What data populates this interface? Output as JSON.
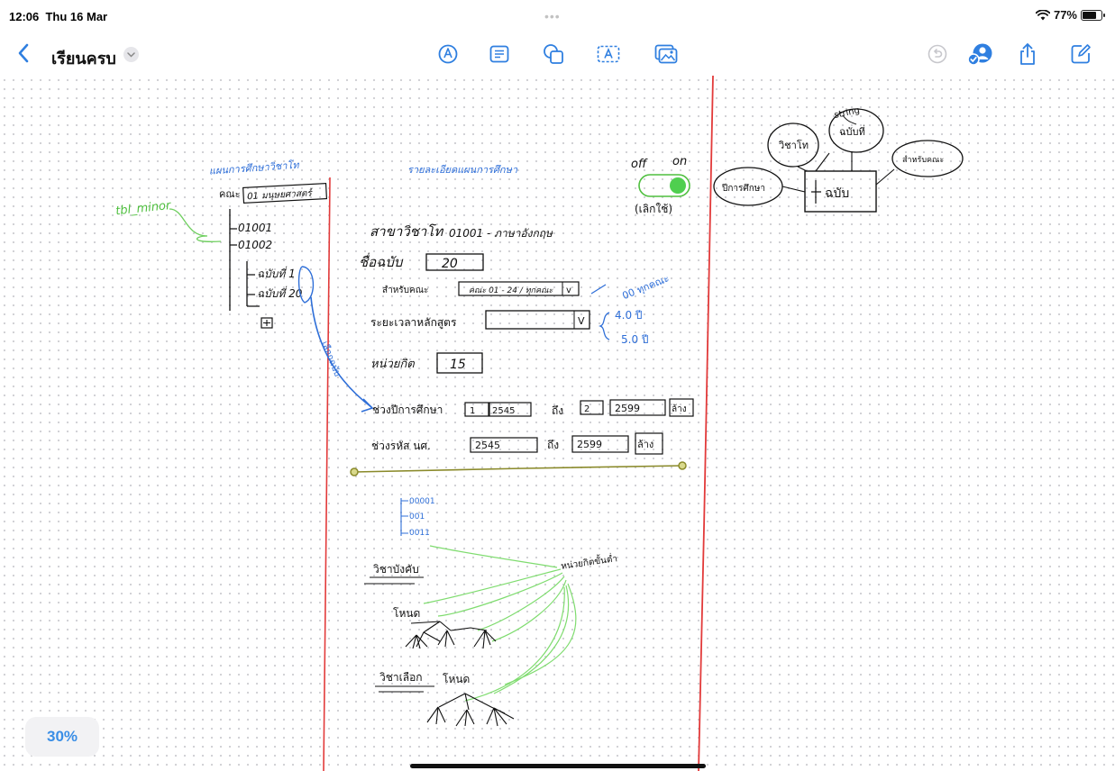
{
  "status_bar": {
    "time": "12:06",
    "date": "Thu 16 Mar",
    "dots": "•••",
    "battery": "77%",
    "battery_level": 0.77
  },
  "toolbar": {
    "title": "เรียนครบ",
    "tools": [
      "pen-tool-icon",
      "text-box-icon",
      "shapes-icon",
      "text-icon",
      "media-icon"
    ],
    "actions": [
      "undo-icon",
      "collaborate-icon",
      "share-icon",
      "compose-icon"
    ],
    "accent": "#2f7fe0"
  },
  "canvas": {
    "zoom": "30%",
    "red_lines_color": "#e23a3a",
    "left_tree": {
      "header": "แผนการศึกษาวิชาโท",
      "table_tag": "tbl_minor",
      "faculty_label": "คณะ",
      "faculty_value": "01 มนุษยศาสตร์",
      "items": [
        "01001",
        "01002"
      ],
      "sub_items": [
        "ฉบับที่ 1",
        "ฉบับที่ 20"
      ],
      "arrow_note": "เลือกฉบับ"
    },
    "form": {
      "header": "รายละเอียดแผนการศึกษา",
      "toggle_off": "off",
      "toggle_on": "on",
      "toggle_caption": "(เลิกใช้)",
      "major_label": "สาขาวิชาโท",
      "major_value": "01001 - ภาษาอังกฤษ",
      "edition_label": "ชื่อฉบับ",
      "edition_value": "20",
      "for_label": "สำหรับคณะ",
      "for_value": "คณะ 01 - 24 / ทุกคณะ",
      "for_note": "00 ทุกคณะ",
      "duration_label": "ระยะเวลาหลักสูตร",
      "duration_options": [
        "4.0 ปี",
        "5.0 ปี"
      ],
      "credits_label": "หน่วยกิต",
      "credits_value": "15",
      "year_range_label": "ช่วงปีการศึกษา",
      "year_from_sem": "1",
      "year_from": "2545",
      "to_word": "ถึง",
      "year_to_sem": "2",
      "year_to": "2599",
      "clear": "ล้าง",
      "id_range_label": "ช่วงรหัส นศ.",
      "id_from": "2545",
      "id_to": "2599",
      "codes": [
        "00001",
        "001",
        "0011"
      ],
      "compulsory_label": "วิชาบังคับ",
      "credit_levels": "หน่วยกิตขั้นต่ำ",
      "node_label": "โหนด",
      "elective_label": "วิชาเลือก"
    },
    "er": {
      "string_label": "string",
      "subject": "วิชาโท",
      "edition_no": "ฉบับที่",
      "for_faculty": "สำหรับคณะ",
      "year": "ปีการศึกษา",
      "entity": "ฉบับ"
    }
  }
}
